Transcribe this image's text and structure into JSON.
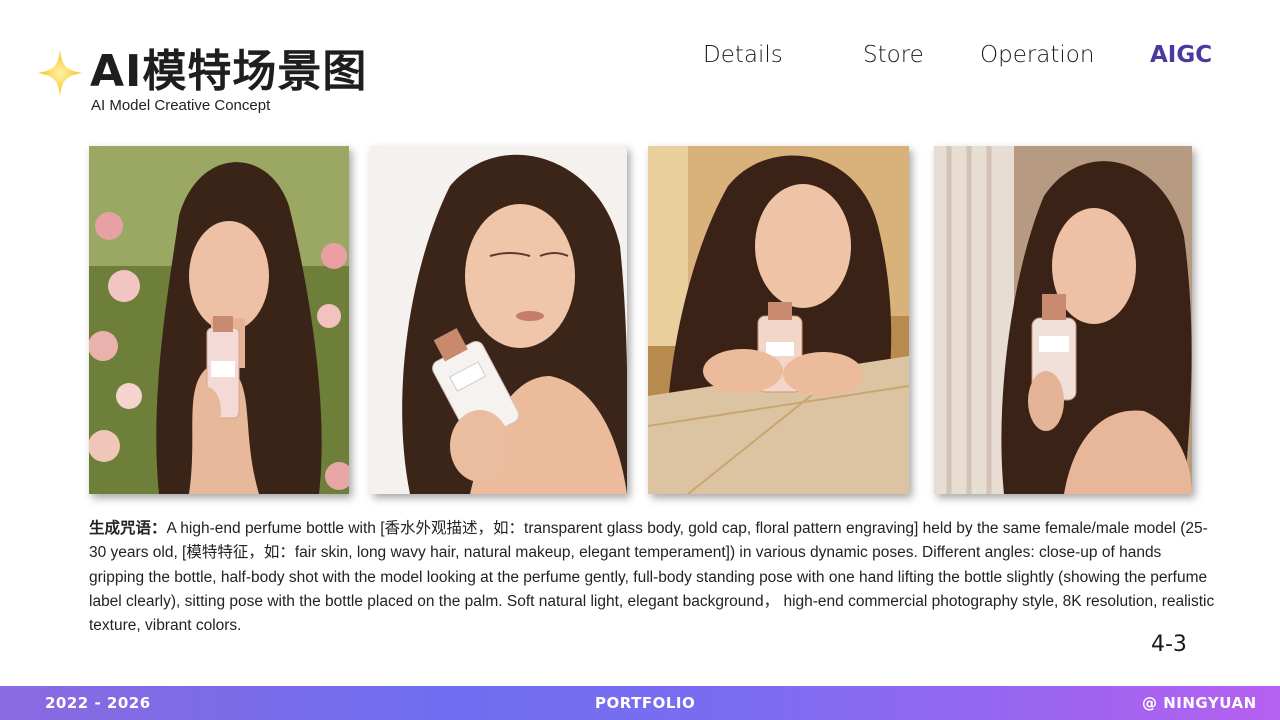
{
  "header": {
    "sparkle_icon": "four-point-star-icon",
    "title": "AI模特场景图",
    "subtitle": "AI Model Creative Concept"
  },
  "nav": {
    "items": [
      {
        "label": "Details",
        "active": false
      },
      {
        "label": "Store",
        "active": false
      },
      {
        "label": "Operation",
        "active": false
      },
      {
        "label": "AIGC",
        "active": true
      }
    ],
    "active_color": "#4a3aa0"
  },
  "gallery": {
    "photos": [
      {
        "scene": "rose-garden",
        "bottle_label": "TENDER Light"
      },
      {
        "scene": "white-studio",
        "bottle_label": "TENDER"
      },
      {
        "scene": "marble-table",
        "bottle_label": "TENDER"
      },
      {
        "scene": "curtain-window",
        "bottle_label": "TENDER Light"
      }
    ]
  },
  "prompt": {
    "label": "生成咒语：",
    "text": "A high-end perfume bottle with [香水外观描述，如：transparent glass body, gold cap, floral pattern engraving] held by the same female/male model (25-30 years old, [模特特征，如：fair skin, long wavy hair, natural makeup, elegant temperament]) in various dynamic poses. Different angles: close-up of hands gripping the bottle, half-body shot with the model looking at the perfume gently, full-body standing pose with one hand lifting the bottle slightly (showing the perfume label clearly), sitting pose with the bottle placed on the palm. Soft natural light, elegant background， high-end commercial photography style, 8K resolution, realistic texture, vibrant colors."
  },
  "page_number": "4-3",
  "footer": {
    "years": "2022 - 2026",
    "center": "PORTFOLIO",
    "author": "@ NINGYUAN",
    "gradient_colors": [
      "#8a6ae0",
      "#6f6ef0",
      "#b560f0"
    ]
  }
}
